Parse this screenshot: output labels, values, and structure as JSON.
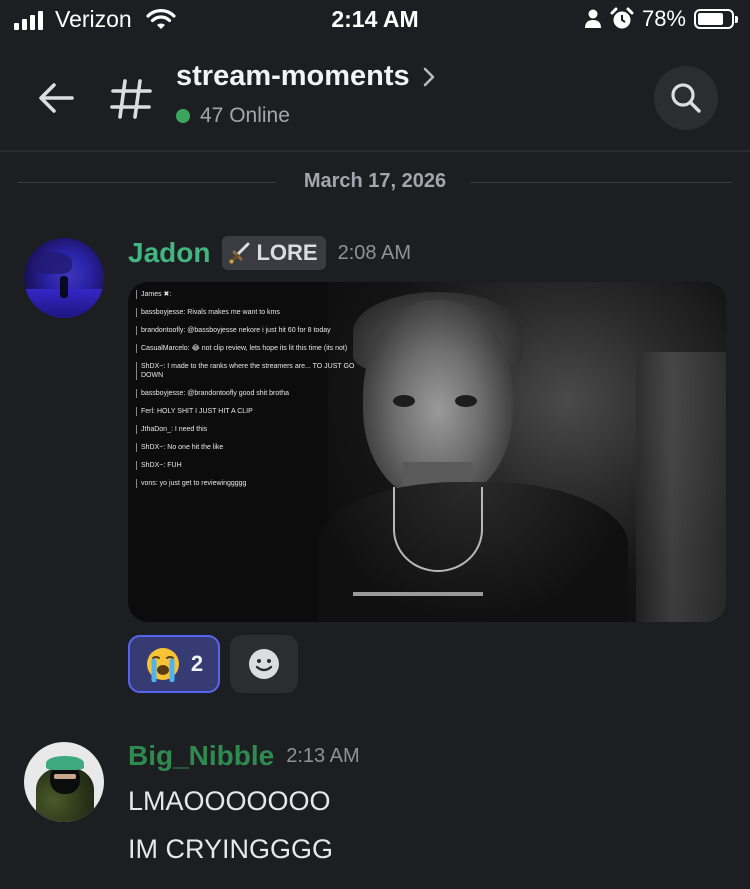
{
  "status_bar": {
    "carrier": "Verizon",
    "time": "2:14 AM",
    "battery_percent": "78%",
    "battery_level": 0.78,
    "icons": [
      "signal-icon",
      "wifi-icon",
      "person-icon",
      "alarm-icon",
      "battery-icon"
    ]
  },
  "header": {
    "channel_name": "stream-moments",
    "online_count": "47 Online",
    "online_color": "#3ba55c",
    "icons": [
      "back-arrow-icon",
      "hash-icon",
      "chevron-right-icon",
      "search-icon"
    ]
  },
  "date_divider": "March 17, 2026",
  "messages": [
    {
      "username": "Jadon",
      "username_color": "#43b581",
      "role": "LORE",
      "role_icon": "sword-icon",
      "time": "2:08 AM",
      "attachment": {
        "type": "image",
        "chat_overlay": [
          "James ✖:",
          "bassboyjesse: Rivals makes me want to kms",
          "brandontoofly: @bassboyjesse nekore i just hit 60 for 8 today",
          "CasualMarcelo: 😂 not clip review, lets hope its lit this time (its not)",
          "ShDX~: I made to the ranks where the streamers are... TO JUST GO DOWN",
          "bassboyjesse: @brandontoofly good shit brotha",
          "Ferl: HOLY SHIT I JUST HIT A CLIP",
          "JthaDon_: I need this",
          "ShDX~: No one hit the like",
          "ShDX~: FUH",
          "vons: yo just get to reviewinggggg"
        ]
      },
      "reactions": [
        {
          "emoji": "loudly-crying-face",
          "count": "2",
          "active": true
        },
        {
          "emoji": "add-reaction-icon",
          "count": "",
          "active": false
        }
      ]
    },
    {
      "username": "Big_Nibble",
      "username_color": "#2f8a4f",
      "time": "2:13 AM",
      "lines": [
        "LMAOOOOOOO",
        "IM CRYINGGGG"
      ]
    }
  ]
}
